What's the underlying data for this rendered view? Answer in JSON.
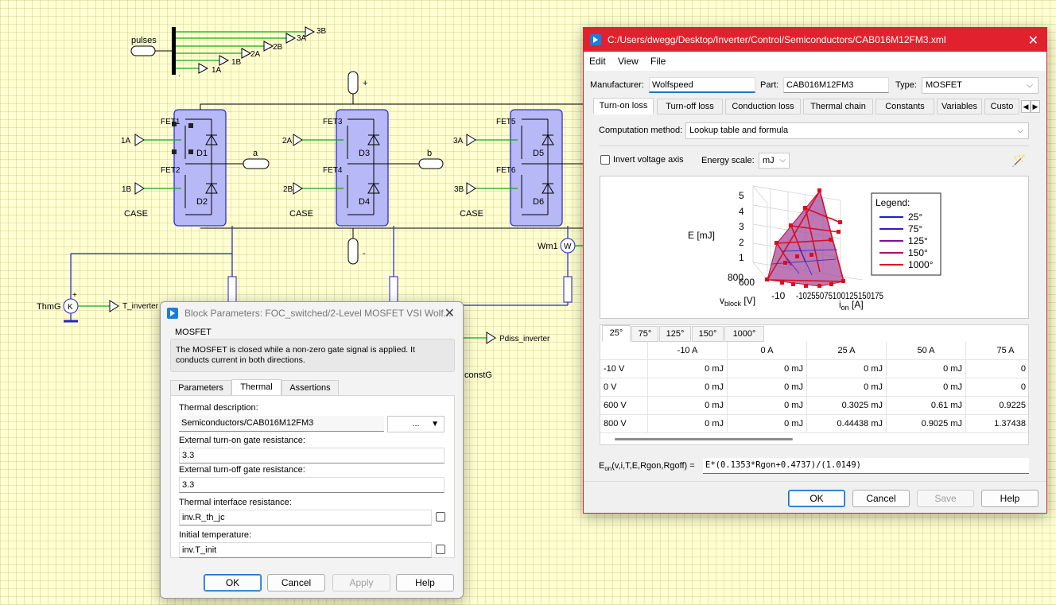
{
  "schematic": {
    "pulses_label": "pulses",
    "pulse_outputs": [
      "3B",
      "3A",
      "2B",
      "2A",
      "1B",
      "1A"
    ],
    "fets": [
      {
        "fet_top": "FET1",
        "diode_top": "D1",
        "fet_bottom": "FET2",
        "diode_bottom": "D2",
        "gate_top": "1A",
        "gate_bottom": "1B",
        "case": "CASE"
      },
      {
        "fet_top": "FET3",
        "diode_top": "D3",
        "fet_bottom": "FET4",
        "diode_bottom": "D4",
        "gate_top": "2A",
        "gate_bottom": "2B",
        "case": "CASE"
      },
      {
        "fet_top": "FET5",
        "diode_top": "D5",
        "fet_bottom": "FET6",
        "diode_bottom": "D6",
        "gate_top": "3A",
        "gate_bottom": "3B",
        "case": "CASE"
      }
    ],
    "port_a": "a",
    "port_b": "b",
    "dc_plus": "+",
    "dc_minus": "-",
    "wattmeter_label": "Wm1",
    "wattmeter_symbol": "W",
    "thermometer_label": "ThmG",
    "thermometer_symbol": "K",
    "thermometer_plus": "+",
    "t_inverter": "T_inverter",
    "pdiss_label": "Pdiss_inverter",
    "constg_label": "constG"
  },
  "block_params": {
    "title": "Block Parameters: FOC_switched/2-Level MOSFET VSI Wolf...",
    "group_title": "MOSFET",
    "description": "The MOSFET is closed while a non-zero gate signal is applied. It conducts current in both directions.",
    "tabs": [
      "Parameters",
      "Thermal",
      "Assertions"
    ],
    "active_tab": "Thermal",
    "thermal_description_label": "Thermal description:",
    "thermal_description_value": "Semiconductors/CAB016M12FM3",
    "browse_button": "...",
    "turn_on_label": "External turn-on gate resistance:",
    "turn_on_value": "3.3",
    "turn_off_label": "External turn-off gate resistance:",
    "turn_off_value": "3.3",
    "interface_label": "Thermal interface resistance:",
    "interface_value": "inv.R_th_jc",
    "initial_temp_label": "Initial temperature:",
    "initial_temp_value": "inv.T_init",
    "buttons": {
      "ok": "OK",
      "cancel": "Cancel",
      "apply": "Apply",
      "help": "Help"
    }
  },
  "xml_editor": {
    "title": "C:/Users/dwegg/Desktop/Inverter/Control/Semiconductors/CAB016M12FM3.xml",
    "menu": [
      "Edit",
      "View",
      "File"
    ],
    "manufacturer_label": "Manufacturer:",
    "manufacturer_value": "Wolfspeed",
    "part_label": "Part:",
    "part_value": "CAB016M12FM3",
    "type_label": "Type:",
    "type_value": "MOSFET",
    "tabs": [
      "Turn-on loss",
      "Turn-off loss",
      "Conduction loss",
      "Thermal chain",
      "Constants",
      "Variables",
      "Custo"
    ],
    "active_tab": "Turn-on loss",
    "computation_label": "Computation method:",
    "computation_value": "Lookup table and formula",
    "invert_label": "Invert voltage axis",
    "energy_scale_label": "Energy scale:",
    "energy_scale_value": "mJ",
    "plot": {
      "z_label": "E [mJ]",
      "z_ticks": [
        "5",
        "4",
        "3",
        "2",
        "1"
      ],
      "v_label": "v",
      "v_sub": "block",
      "v_unit": " [V]",
      "v_ticks": [
        "800",
        "600",
        "0",
        "-10"
      ],
      "i_label": "i",
      "i_sub": "on",
      "i_unit": " [A]",
      "i_tick_text": "-10255075100125150175",
      "legend_title": "Legend:",
      "legend": [
        {
          "name": "25°",
          "color": "#1f1fd6"
        },
        {
          "name": "75°",
          "color": "#3a16c4"
        },
        {
          "name": "125°",
          "color": "#7b10a0"
        },
        {
          "name": "150°",
          "color": "#b40a6a"
        },
        {
          "name": "1000°",
          "color": "#e00c1a"
        }
      ]
    },
    "temp_tabs": [
      "25°",
      "75°",
      "125°",
      "150°",
      "1000°"
    ],
    "active_temp": "25°",
    "table": {
      "columns": [
        "-10 A",
        "0 A",
        "25 A",
        "50 A",
        "75 A"
      ],
      "rows": [
        {
          "label": "-10 V",
          "cells": [
            "0 mJ",
            "0 mJ",
            "0 mJ",
            "0 mJ",
            "0"
          ]
        },
        {
          "label": "0 V",
          "cells": [
            "0 mJ",
            "0 mJ",
            "0 mJ",
            "0 mJ",
            "0"
          ]
        },
        {
          "label": "600 V",
          "cells": [
            "0 mJ",
            "0 mJ",
            "0.3025 mJ",
            "0.61 mJ",
            "0.9225"
          ]
        },
        {
          "label": "800 V",
          "cells": [
            "0 mJ",
            "0 mJ",
            "0.44438 mJ",
            "0.9025 mJ",
            "1.37438"
          ]
        }
      ]
    },
    "formula_label_main": "E",
    "formula_label_sub": "on",
    "formula_label_rest": "(v,i,T,E,Rgon,Rgoff) =",
    "formula_value": "E*(0.1353*Rgon+0.4737)/(1.0149)",
    "buttons": {
      "ok": "OK",
      "cancel": "Cancel",
      "save": "Save",
      "help": "Help"
    },
    "colors": {
      "titlebar": "#e1222e",
      "surface_fill": "#a64c9c"
    }
  }
}
